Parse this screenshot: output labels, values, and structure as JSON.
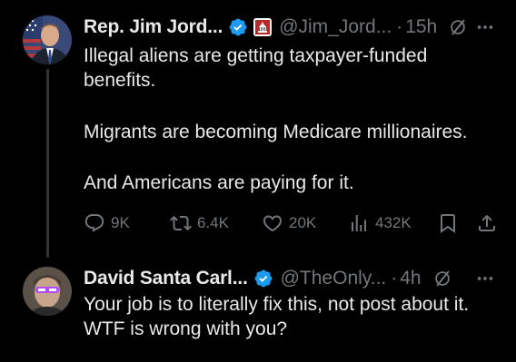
{
  "colors": {
    "background": "#000000",
    "text": "#e7e9ea",
    "secondary": "#71767b",
    "verified": "#1d9bf0",
    "thread_line": "#333639"
  },
  "tweet": {
    "author_name": "Rep. Jim Jord...",
    "handle": "@Jim_Jord...",
    "separator": "·",
    "time": "15h",
    "text_lines": [
      "Illegal aliens are getting taxpayer-funded benefits.",
      "Migrants are becoming Medicare millionaires.",
      "And Americans are paying for it."
    ],
    "stats": {
      "replies": "9K",
      "reposts": "6.4K",
      "likes": "20K",
      "views": "432K"
    }
  },
  "reply": {
    "author_name": "David Santa Carl...",
    "handle": "@TheOnly...",
    "separator": "·",
    "time": "4h",
    "text": "Your job is to literally fix this, not post about it. WTF is wrong with you?"
  },
  "icons": {
    "verified": "verified-badge-icon",
    "affiliation": "us-capitol-affiliation-icon",
    "grok": "grok-icon",
    "more": "more-options-icon",
    "reply": "reply-icon",
    "repost": "repost-icon",
    "like": "like-icon",
    "views": "views-icon",
    "bookmark": "bookmark-icon",
    "share": "share-icon"
  }
}
